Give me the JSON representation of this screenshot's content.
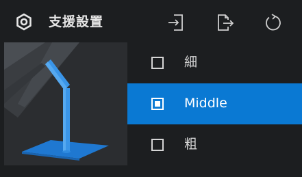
{
  "header": {
    "title": "支援設置",
    "icon": "hexagon-settings-icon",
    "buttons": [
      {
        "name": "import-icon"
      },
      {
        "name": "export-icon"
      },
      {
        "name": "reset-icon"
      }
    ]
  },
  "options": [
    {
      "label": "細",
      "checked": false
    },
    {
      "label": "Middle",
      "checked": true
    },
    {
      "label": "粗",
      "checked": false
    }
  ],
  "colors": {
    "background": "#1c1e20",
    "selected": "#0a79d3",
    "support_model": "#2f8be0",
    "text": "#d4d4d4"
  }
}
